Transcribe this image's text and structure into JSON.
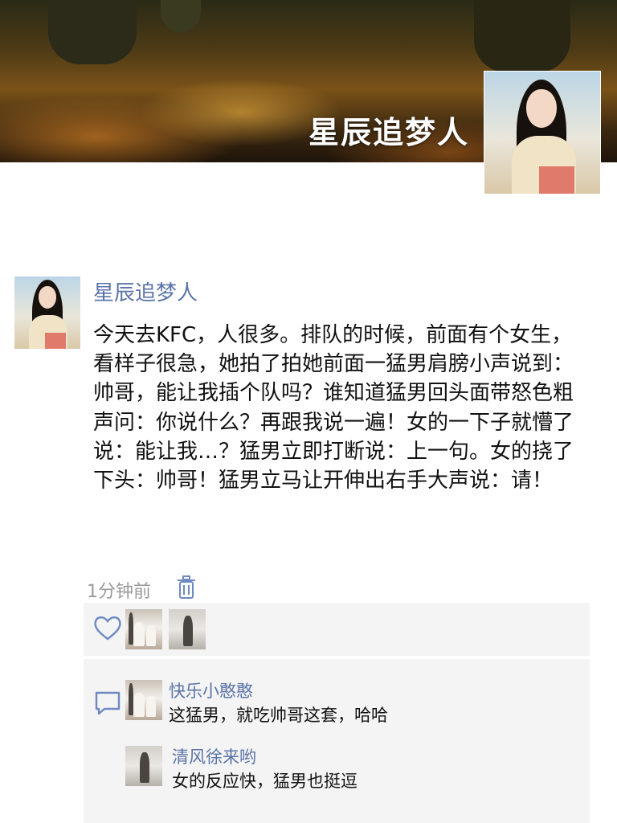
{
  "header": {
    "cover_title": "星辰追梦人"
  },
  "post": {
    "author": "星辰追梦人",
    "body": "今天去KFC，人很多。排队的时候，前面有个女生，看样子很急，她拍了拍她前面一猛男肩膀小声说到：帅哥，能让我插个队吗？谁知道猛男回头面带怒色粗声问：你说什么？再跟我说一遍！女的一下子就懵了说：能让我…？猛男立即打断说：上一句。女的挠了下头：帅哥！猛男立马让开伸出右手大声说：请！",
    "time": "1分钟前"
  },
  "comments": [
    {
      "author": "快乐小憨憨",
      "text": "这猛男，就吃帅哥这套，哈哈"
    },
    {
      "author": "清风徐来哟",
      "text": "女的反应快，猛男也挺逗"
    }
  ],
  "colors": {
    "link_blue": "#5a73a8",
    "panel_bg": "#f4f4f4",
    "muted_text": "#9a9a9a"
  },
  "icons": [
    "heart-icon",
    "comment-icon",
    "trash-icon"
  ]
}
